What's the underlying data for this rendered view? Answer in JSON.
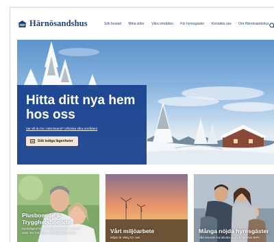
{
  "header": {
    "logo_text": "Härnösandshus",
    "nav": [
      "Sök bostad",
      "Mina sidor",
      "Våra områden",
      "För hyresgäster",
      "Kontakta oss",
      "Om Härnösandshus"
    ]
  },
  "hero": {
    "title_line1": "Hitta ditt nya hem",
    "title_line2": "hos oss",
    "link_text": "Var vill du bo i Härnösand? Utforska våra områden!",
    "button_label": "Sök lediga lägenheter"
  },
  "cards": [
    {
      "title_line1": "Plusboende &",
      "title_line2": "Trygghetsboende",
      "desc_line1": "Hyreslägenheter för dig som är 55+ och 65+",
      "desc_line2": "samt inte har några hemmaboende barn."
    },
    {
      "title": "Vårt miljöarbete",
      "desc": "Miljön är viktig för oss!"
    },
    {
      "title": "Många nöjda hyresgäster",
      "desc": "Vårt senaste Kundindex gav på närmare 90%."
    }
  ],
  "colors": {
    "brand_blue": "#1f3d7a",
    "hero_card": "#173e8c",
    "button_bg": "#f5e6d8"
  }
}
